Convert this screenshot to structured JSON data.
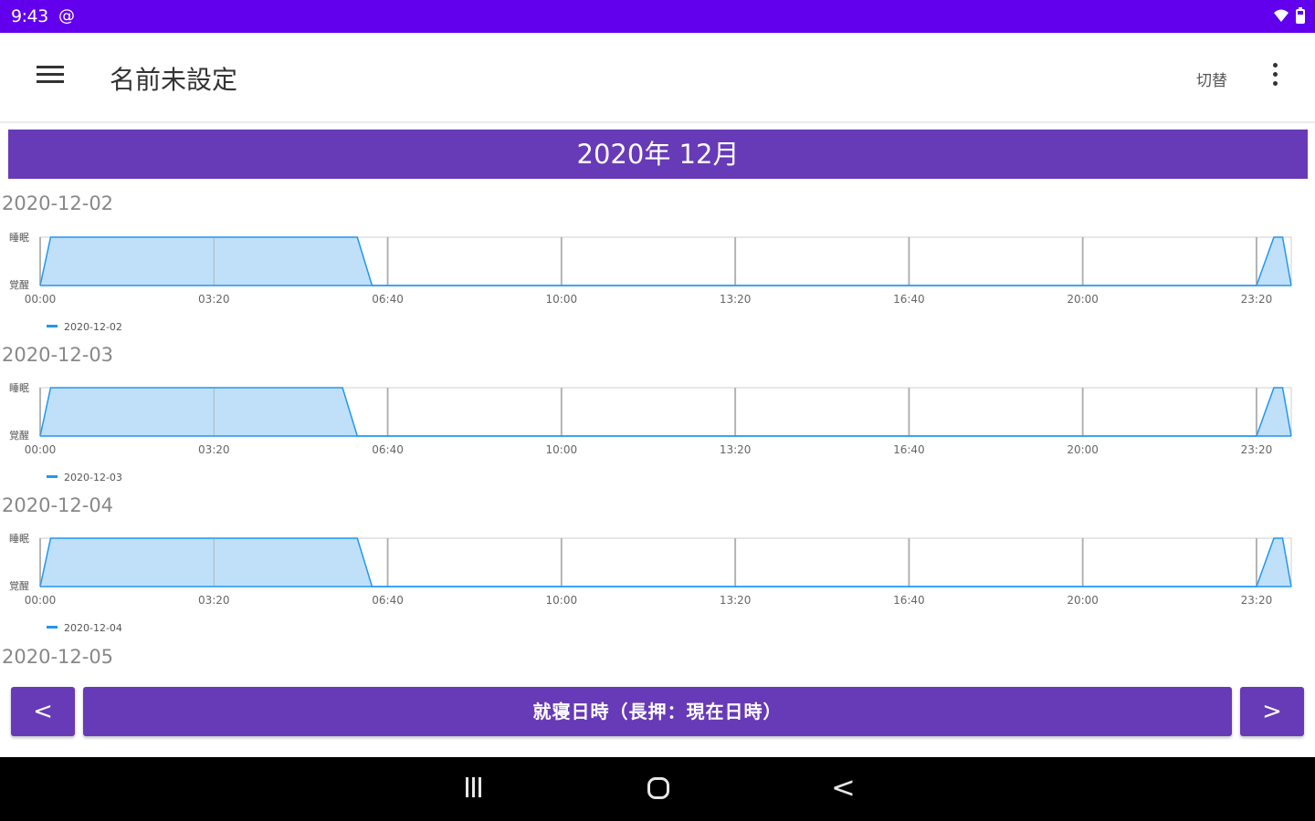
{
  "status_bar": {
    "time": "9:43",
    "extra_icon": "@",
    "icons": [
      "wifi-icon",
      "battery-icon"
    ]
  },
  "toolbar": {
    "title": "名前未設定",
    "switch_label": "切替",
    "menu_icon": "hamburger-menu-icon",
    "more_icon": "more-vert-icon"
  },
  "month_header": "2020年 12月",
  "chart_data": [
    {
      "type": "area",
      "day_label": "2020-12-02",
      "series": [
        {
          "name": "2020-12-02",
          "x": [
            "00:00",
            "00:12",
            "06:05",
            "06:22",
            "23:20",
            "23:40",
            "23:50",
            "24:00"
          ],
          "values": [
            0,
            1,
            1,
            0,
            0,
            1,
            1,
            0
          ]
        }
      ],
      "x_ticks": [
        "00:00",
        "03:20",
        "06:40",
        "10:00",
        "13:20",
        "16:40",
        "20:00",
        "23:20"
      ],
      "y_ticks": [
        "睡眠",
        "覚醒"
      ],
      "grid": true,
      "legend": "bottom-left",
      "color": "#2196f3"
    },
    {
      "type": "area",
      "day_label": "2020-12-03",
      "series": [
        {
          "name": "2020-12-03",
          "x": [
            "00:00",
            "00:12",
            "05:48",
            "06:05",
            "23:20",
            "23:40",
            "23:50",
            "24:00"
          ],
          "values": [
            0,
            1,
            1,
            0,
            0,
            1,
            1,
            0
          ]
        }
      ],
      "x_ticks": [
        "00:00",
        "03:20",
        "06:40",
        "10:00",
        "13:20",
        "16:40",
        "20:00",
        "23:20"
      ],
      "y_ticks": [
        "睡眠",
        "覚醒"
      ],
      "grid": true,
      "legend": "bottom-left",
      "color": "#2196f3"
    },
    {
      "type": "area",
      "day_label": "2020-12-04",
      "series": [
        {
          "name": "2020-12-04",
          "x": [
            "00:00",
            "00:12",
            "06:05",
            "06:22",
            "23:20",
            "23:40",
            "23:50",
            "24:00"
          ],
          "values": [
            0,
            1,
            1,
            0,
            0,
            1,
            1,
            0
          ]
        }
      ],
      "x_ticks": [
        "00:00",
        "03:20",
        "06:40",
        "10:00",
        "13:20",
        "16:40",
        "20:00",
        "23:20"
      ],
      "y_ticks": [
        "睡眠",
        "覚醒"
      ],
      "grid": true,
      "legend": "bottom-left",
      "color": "#2196f3"
    }
  ],
  "next_day_label": "2020-12-05",
  "bottom_controls": {
    "prev_label": "<",
    "main_label": "就寝日時（長押：現在日時）",
    "next_label": ">"
  },
  "system_nav": {
    "recent_icon": "recent-apps-icon",
    "home_icon": "home-icon",
    "back_icon": "back-icon",
    "back_glyph": "<"
  }
}
